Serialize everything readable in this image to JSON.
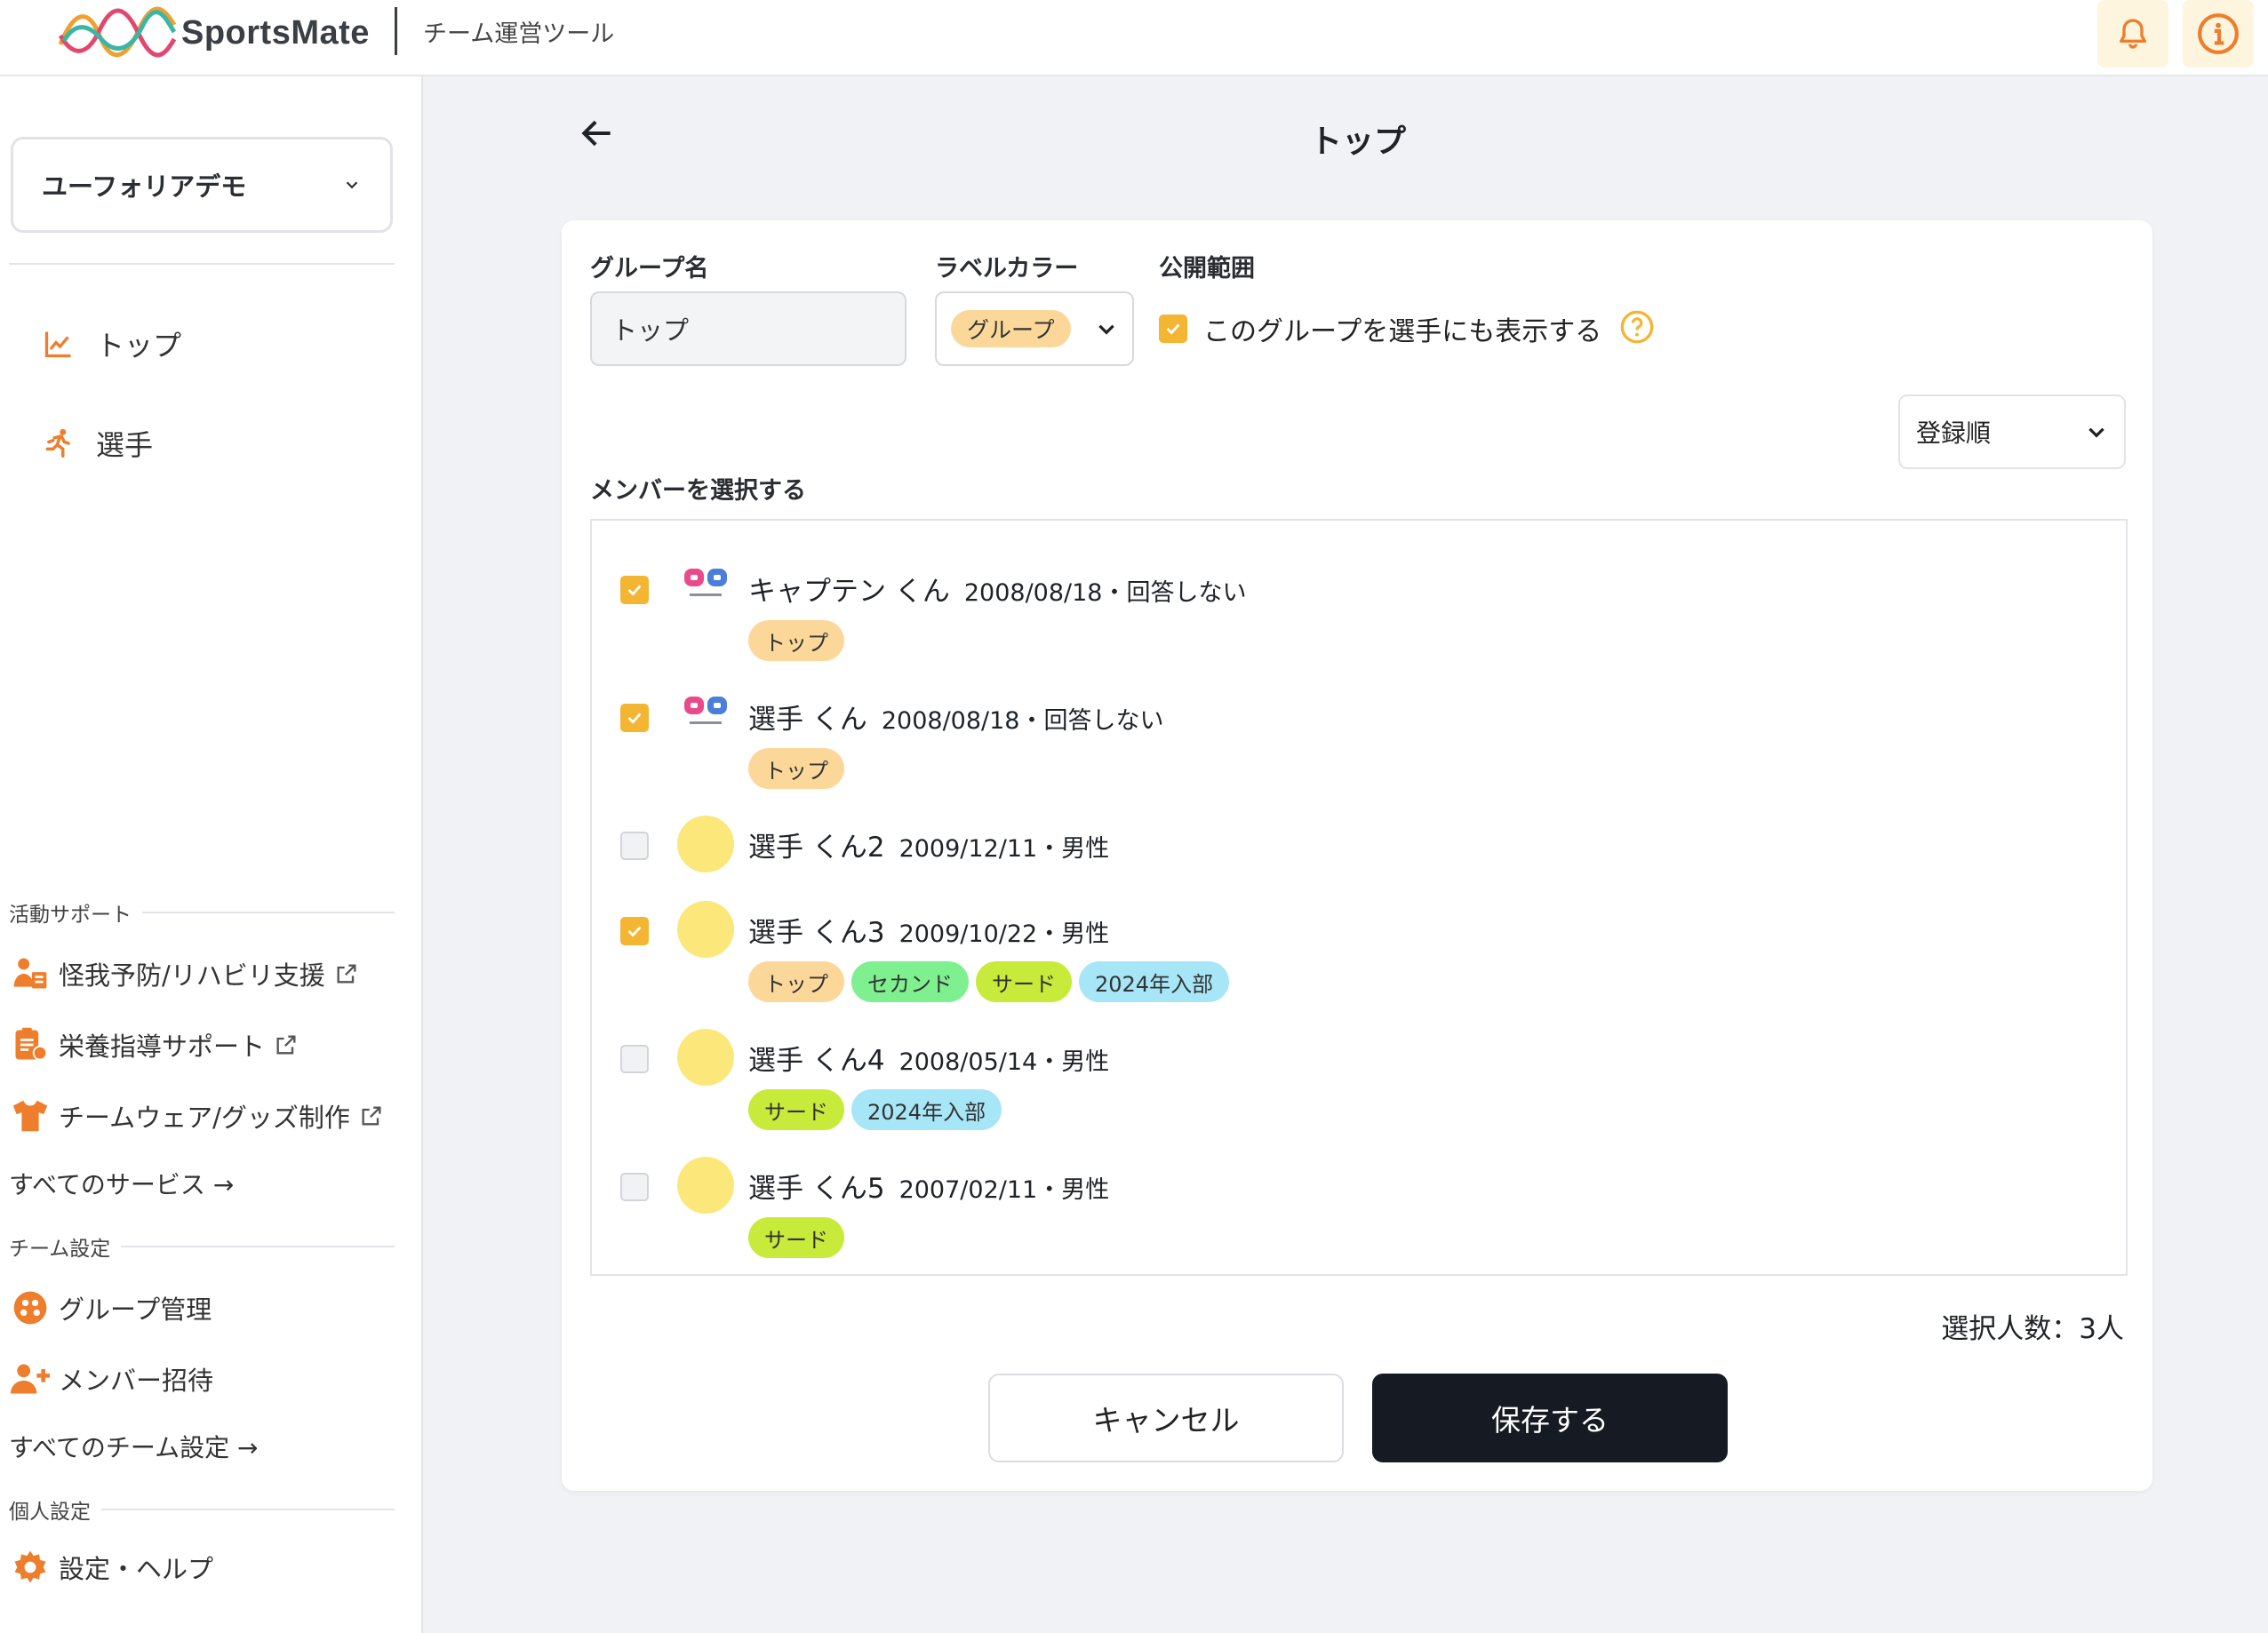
{
  "header": {
    "logo_text": "SportsMate",
    "subtitle": "チーム運営ツール",
    "notification_icon": "bell-icon",
    "info_icon": "info-icon"
  },
  "sidebar": {
    "team": "ユーフォリアデモ",
    "nav": [
      {
        "label": "トップ",
        "icon": "chart-line-icon"
      },
      {
        "label": "選手",
        "icon": "running-icon"
      }
    ],
    "sections": {
      "activity": "活動サポート",
      "team_settings": "チーム設定",
      "personal": "個人設定"
    },
    "services": [
      {
        "label": "怪我予防/リハビリ支援",
        "icon": "medical-staff-icon"
      },
      {
        "label": "栄養指導サポート",
        "icon": "clipboard-icon"
      },
      {
        "label": "チームウェア/グッズ制作",
        "icon": "tshirt-icon"
      }
    ],
    "all_services": "すべてのサービス →",
    "team_items": [
      {
        "label": "グループ管理",
        "icon": "group-icon"
      },
      {
        "label": "メンバー招待",
        "icon": "add-user-icon"
      }
    ],
    "all_team_settings": "すべてのチーム設定 →",
    "personal_items": [
      {
        "label": "設定・ヘルプ",
        "icon": "gear-icon"
      }
    ]
  },
  "page": {
    "title": "トップ"
  },
  "form": {
    "group_name_label": "グループ名",
    "group_name_value": "トップ",
    "label_color_label": "ラベルカラー",
    "label_color_value": "グループ",
    "visibility_label": "公開範囲",
    "visibility_text": "このグループを選手にも表示する",
    "visibility_checked": true,
    "sort_value": "登録順",
    "members_label": "メンバーを選択する",
    "selected_count": "選択人数：3人",
    "cancel": "キャンセル",
    "save": "保存する"
  },
  "members": [
    {
      "name": "キャプテン くん",
      "meta": "2008/08/18・回答しない",
      "checked": true,
      "avatar": "logo",
      "tags": [
        "トップ"
      ]
    },
    {
      "name": "選手 くん",
      "meta": "2008/08/18・回答しない",
      "checked": true,
      "avatar": "logo",
      "tags": [
        "トップ"
      ]
    },
    {
      "name": "選手 くん2",
      "meta": "2009/12/11・男性",
      "checked": false,
      "avatar": "circle",
      "tags": []
    },
    {
      "name": "選手 くん3",
      "meta": "2009/10/22・男性",
      "checked": true,
      "avatar": "circle",
      "tags": [
        "トップ",
        "セカンド",
        "サード",
        "2024年入部"
      ]
    },
    {
      "name": "選手 くん4",
      "meta": "2008/05/14・男性",
      "checked": false,
      "avatar": "circle",
      "tags": [
        "サード",
        "2024年入部"
      ]
    },
    {
      "name": "選手 くん5",
      "meta": "2007/02/11・男性",
      "checked": false,
      "avatar": "circle",
      "tags": [
        "サード"
      ]
    }
  ],
  "tag_colors": {
    "トップ": "#fbd89a",
    "セカンド": "#7ef08f",
    "サード": "#c8ea3a",
    "2024年入部": "#a7e6f7"
  },
  "colors": {
    "accent": "#f4b533",
    "brand_orange": "#ee7d2c",
    "save_button": "#161a22"
  }
}
